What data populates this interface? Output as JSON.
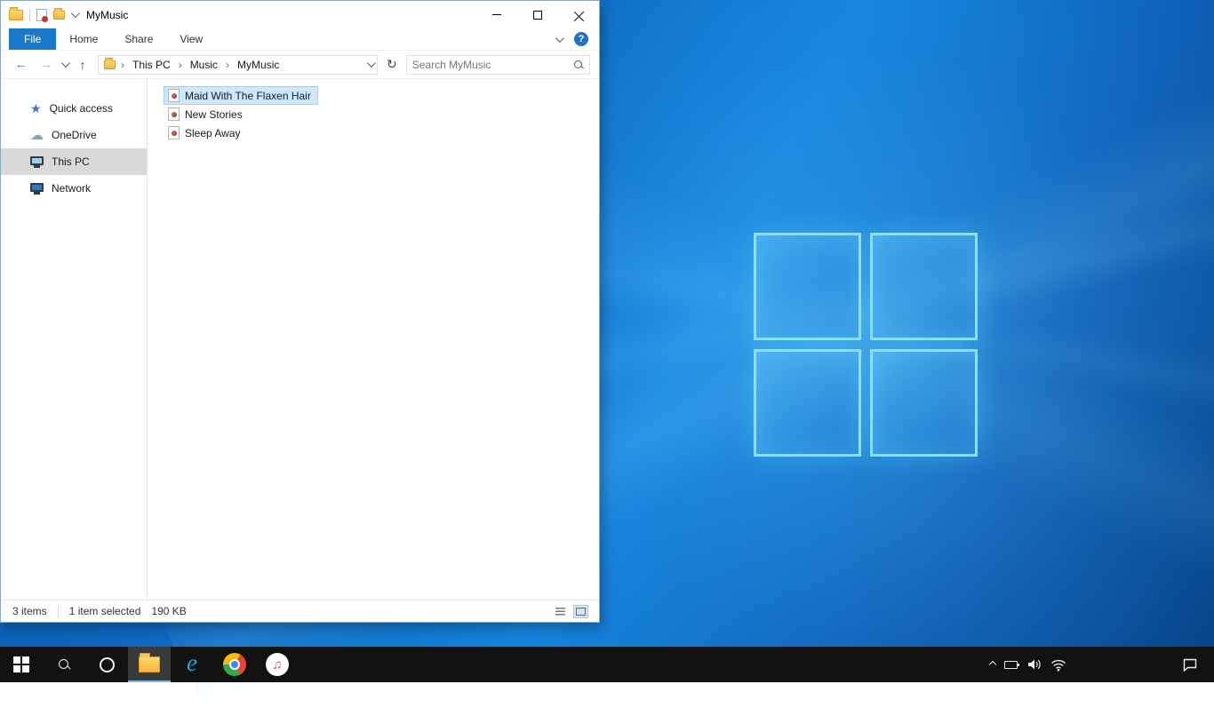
{
  "window": {
    "title": "MyMusic"
  },
  "ribbon": {
    "tabs": [
      "File",
      "Home",
      "Share",
      "View"
    ],
    "help_label": "?"
  },
  "navigation": {
    "back": "←",
    "forward": "→",
    "up": "↑",
    "refresh": "↻",
    "breadcrumb": [
      "This PC",
      "Music",
      "MyMusic"
    ],
    "breadcrumb_separator": "›",
    "search_placeholder": "Search MyMusic"
  },
  "sidebar": {
    "items": [
      {
        "label": "Quick access",
        "icon": "star"
      },
      {
        "label": "OneDrive",
        "icon": "cloud"
      },
      {
        "label": "This PC",
        "icon": "monitor",
        "selected": true
      },
      {
        "label": "Network",
        "icon": "network-monitor"
      }
    ],
    "star_glyph": "★",
    "cloud_glyph": "☁"
  },
  "files": {
    "items": [
      {
        "name": "Maid With The Flaxen Hair",
        "selected": true
      },
      {
        "name": "New Stories",
        "selected": false
      },
      {
        "name": "Sleep Away",
        "selected": false
      }
    ]
  },
  "statusbar": {
    "items_count": "3 items",
    "selection": "1 item selected",
    "selection_size": "190 KB"
  },
  "taskbar": {
    "icons": [
      "start",
      "search",
      "cortana",
      "file-explorer",
      "internet-explorer",
      "chrome",
      "itunes"
    ],
    "tray_icons": [
      "hidden-icons-chevron",
      "battery",
      "volume",
      "wifi",
      "action-center"
    ],
    "itunes_glyph": "♫",
    "ie_glyph": "e"
  },
  "colors": {
    "accent_blue": "#1979ca",
    "selection_fill": "#cce8ff",
    "selection_border": "#99d1ff",
    "taskbar": "#121212",
    "wallpaper_blue": "#0e6bc2",
    "logo_cyan": "#91e4ff"
  }
}
